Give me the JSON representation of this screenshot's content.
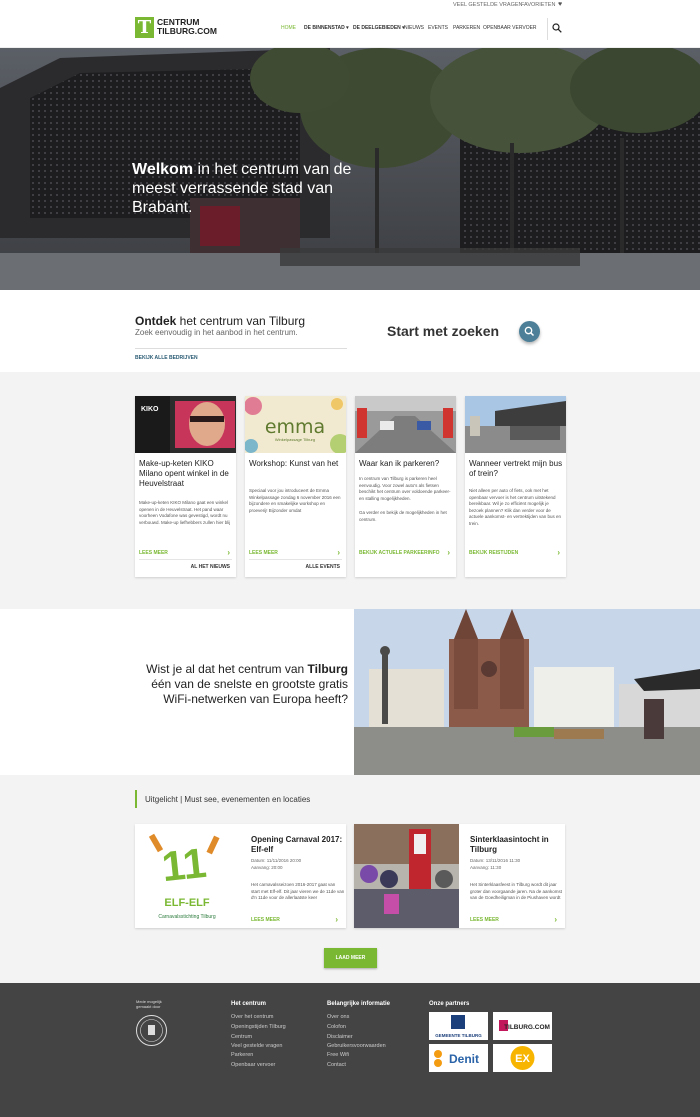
{
  "topbar": {
    "faq": "VEEL GESTELDE VRAGEN",
    "favorites": "FAVORIETEN"
  },
  "logo": {
    "line1": "CENTRUM",
    "line2": "TILBURG.COM",
    "letter": "T"
  },
  "nav": {
    "home": "HOME",
    "binnenstad": "DE BINNENSTAD",
    "deelgebieden": "DE DEELGEBIEDEN",
    "nieuws": "NIEUWS",
    "events": "EVENTS",
    "parkeren": "PARKEREN",
    "ov": "OPENBAAR VERVOER"
  },
  "hero": {
    "bold": "Welkom",
    "rest": " in het centrum van de meest verrassende stad van Brabant."
  },
  "discover": {
    "title_bold": "Ontdek",
    "title_rest": " het centrum van Tilburg",
    "subtitle": "Zoek eenvoudig in het aanbod in het centrum.",
    "link": "BEKIJK ALLE BEDRIJVEN",
    "start": "Start met zoeken"
  },
  "cards": [
    {
      "title": "Make-up-keten KIKO Milano opent winkel in de Heuvelstraat",
      "text": "Make-up-keten KIKO Milano gaat een winkel openen in de Heuvelstraat. Het pand waar voorheen Vodafone was gevestigd, wordt nu verbouwd. Make-up liefhebbers zullen hier blij",
      "more": "LEES MEER",
      "all": "AL HET NIEUWS",
      "img_label": "KIKO"
    },
    {
      "title": "Workshop: Kunst van het",
      "text": "Speciaal voor jou introduceert de Emma Winkelpassage zondag 6 november 2016 een bijzondere en smakelijke workshop en proeverij! Bijzonder omdat",
      "more": "LEES MEER",
      "all": "ALLE EVENTS",
      "img_label": "emma",
      "img_sub": "Winkelpassage Tilburg"
    },
    {
      "title": "Waar kan ik parkeren?",
      "text": "In centrum van Tilburg is parkeren heel eenvoudig. Voor zowel auto's als fietsen beschikt het centrum over voldoende parkeer- en stalling mogelijkheden.",
      "text2": "Ga verder en bekijk de mogelijkheden in het centrum.",
      "more": "BEKIJK ACTUELE PARKEERINFO"
    },
    {
      "title": "Wanneer vertrekt mijn bus of trein?",
      "text": "Niet alleen per auto of fiets, ook met het openbaar vervoer is het centrum uitstekend bereikbaar. Wil je zo efficiënt mogelijk je bezoek plannen? Klik dan verder voor de actuele aankomst- en vertrektijden van bus en trein.",
      "more": "BEKIJK REISTIJDEN"
    }
  ],
  "wifi": {
    "part1": "Wist je al dat het centrum van ",
    "bold": "Tilburg",
    "part2": " één van de snelste en grootste gratis WiFi-netwerken van Europa heeft?"
  },
  "uitgelicht": {
    "title": "Uitgelicht | Must see, evenementen en locaties"
  },
  "events": [
    {
      "title": "Opening Carnaval 2017: Elf-elf",
      "date": "Datum: 11/11/2016 20:00",
      "arrival": "Aanvang: 20:00",
      "desc": "Het carnavalsseizoen 2016-2017 gaat van start met Elf-elf. Dit jaar vieren we de 11de van d'n 11de voor de allerlaatste keer",
      "more": "LEES MEER",
      "img_big": "11",
      "img_word": "ELF-ELF",
      "img_foot": "Carnavalsstichting Tilburg"
    },
    {
      "title": "Sinterklaasintocht in Tilburg",
      "date": "Datum: 13/11/2016 11:30",
      "arrival": "Aanvang: 11:30",
      "desc": "Het Sinterklaasfeest in Tilburg wordt dit jaar groter dan voorgaande jaren. Na de aankomst van de Goedheiligman in de Piushaven wordt",
      "more": "LEES MEER"
    }
  ],
  "load_more": "LAAD MEER",
  "footer": {
    "made": "Mede mogelijk gemaakt door",
    "col1_title": "Het centrum",
    "col1": [
      "Over het centrum",
      "Openingstijden Tilburg",
      "Centrum",
      "Veel gestelde vragen",
      "Parkeren",
      "Openbaar vervoer"
    ],
    "col2_title": "Belangrijke informatie",
    "col2": [
      "Over ons",
      "Colofon",
      "Disclaimer",
      "Gebruikersvoorwaarden",
      "Free Wifi",
      "Contact"
    ],
    "col3_title": "Onze partners",
    "partners": [
      "GEMEENTE TILBURG",
      "TILBURG.COM",
      "Denit",
      "EX"
    ]
  },
  "colors": {
    "green": "#7ab833",
    "footer": "#444444",
    "search_btn": "#4d8098"
  }
}
